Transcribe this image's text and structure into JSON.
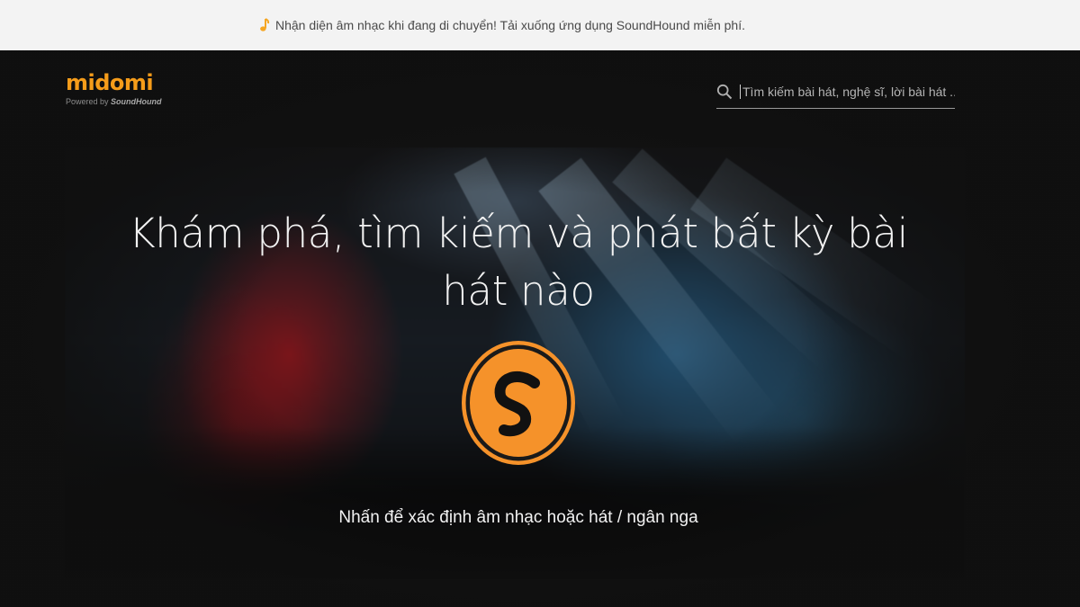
{
  "banner": {
    "icon": "music-note-icon",
    "text": "Nhận diện âm nhạc khi đang di chuyển! Tải xuống ứng dụng SoundHound miễn phí.",
    "icon_color": "#f5a623"
  },
  "header": {
    "logo": "midomi",
    "powered_by": "Powered by",
    "powered_brand": "SoundHound",
    "brand_color": "#f59c1a"
  },
  "search": {
    "icon": "search-icon",
    "placeholder": "Tìm kiếm bài hát, nghệ sĩ, lời bài hát ..."
  },
  "hero": {
    "headline": "Khám phá, tìm kiếm và phát bất kỳ bài hát nào",
    "button_icon": "soundhound-icon",
    "button_color": "#f5922a",
    "cta": "Nhấn để xác định âm nhạc hoặc hát / ngân nga"
  }
}
